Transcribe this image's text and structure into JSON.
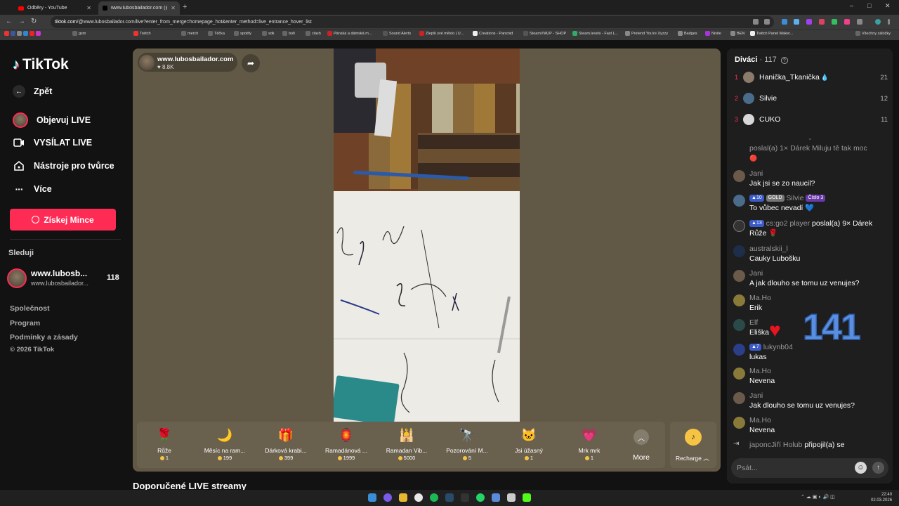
{
  "browser": {
    "tabs": [
      {
        "title": "Odběry - YouTube"
      },
      {
        "title": "www.lubosbailador.com (@l..."
      }
    ],
    "url_host": "tiktok.com",
    "url_rest": "/@www.lubosbailador.com/live?enter_from_merge=homepage_hot&enter_method=live_entrance_hover_list",
    "bookmarks": [
      "gsm",
      "Twitch",
      "merch",
      "Těčka",
      "spotify",
      "sdk",
      "bolt",
      "clash",
      "Pánská a dámská m...",
      "Sound Alerts",
      "Zlepši své město | U...",
      "Creations - Panzoid",
      "SteamVMUP - SHOP",
      "Steam.levels - Fast L...",
      "Pretend You're Xyzzy",
      "Badges",
      "Nivite",
      "BEN",
      "Twitch Panel Maker..."
    ],
    "bookmarks_right": "Všechny záložky"
  },
  "sidebar": {
    "logo": "TikTok",
    "back": "Zpět",
    "nav": [
      {
        "label": "Objevuj LIVE",
        "icon": "avatar-icon"
      },
      {
        "label": "VYSÍLAT LIVE",
        "icon": "video-camera-icon"
      },
      {
        "label": "Nástroje pro tvůrce",
        "icon": "home-icon"
      },
      {
        "label": "Více",
        "icon": "more-dots-icon"
      }
    ],
    "coins_button": "Získej Mince",
    "following_title": "Sleduji",
    "following": {
      "name": "www.lubosb...",
      "handle": "www.lubosbailador...",
      "count": "118"
    },
    "footer": [
      "Společnost",
      "Program",
      "Podmínky a zásady",
      "© 2026 TikTok"
    ]
  },
  "stream": {
    "host_name": "www.lubosbailador.com",
    "host_likes": "8.8K"
  },
  "gifts": [
    {
      "name": "Růže",
      "price": "1",
      "icon": "rose-icon",
      "glyph": "🌹"
    },
    {
      "name": "Měsíc na ram...",
      "price": "199",
      "icon": "moon-icon",
      "glyph": "🌙"
    },
    {
      "name": "Dárková krabi...",
      "price": "399",
      "icon": "gift-box-icon",
      "glyph": "🎁"
    },
    {
      "name": "Ramadánová ...",
      "price": "1999",
      "icon": "lantern-icon",
      "glyph": "🏮"
    },
    {
      "name": "Ramadan Vib...",
      "price": "5000",
      "icon": "mosque-icon",
      "glyph": "🕌"
    },
    {
      "name": "Pozorování M...",
      "price": "5",
      "icon": "telescope-icon",
      "glyph": "🔭"
    },
    {
      "name": "Jsi úžasný",
      "price": "1",
      "icon": "cat-icon",
      "glyph": "🐱"
    },
    {
      "name": "Mrk mrk",
      "price": "1",
      "icon": "heart-icon",
      "glyph": "💗"
    }
  ],
  "gift_more": "More",
  "recharge": "Recharge",
  "recommended_title": "Doporučené LIVE streamy",
  "chat": {
    "viewers_label": "Diváci",
    "viewers_count": "117",
    "top_viewers": [
      {
        "rank": "1",
        "name": "Hanička_Tkanička",
        "score": "21",
        "color": "#8a7b6b"
      },
      {
        "rank": "2",
        "name": "Silvie",
        "score": "12",
        "color": "#4a6b8a"
      },
      {
        "rank": "3",
        "name": "CUKO",
        "score": "11",
        "color": "#d8d8d8"
      }
    ],
    "partial_msg": "poslal(a) 1× Dárek Miluju tě tak moc",
    "messages": [
      {
        "name": "Jani",
        "text": "Jak jsi se zo naucil?",
        "color": "#6b5a4a"
      },
      {
        "name": "Silvie",
        "badge1": "10",
        "badge2": "GOLD",
        "badge3": "Číslo 3",
        "text": "To vůbec nevadí 💙",
        "color": "#4a6b8a"
      },
      {
        "name": "cs:go2 player",
        "badge1": "13",
        "text": "poslal(a) 9× Dárek Růže 🌹",
        "color": "#333"
      },
      {
        "name": "australskii_l",
        "text": "Cauky Lubošku",
        "color": "#1e2e4a"
      },
      {
        "name": "Jani",
        "text": "A jak dlouho se tomu uz venujes?",
        "color": "#6b5a4a"
      },
      {
        "name": "Ma.Ho",
        "text": "Erik",
        "color": "#8a7a3a"
      },
      {
        "name": "Elf",
        "text": "Eliška",
        "color": "#2a4a4a"
      },
      {
        "name": "lukynb04",
        "badge1": "7",
        "text": "lukas",
        "color": "#2a3e8a"
      },
      {
        "name": "Ma.Ho",
        "text": "Nevena",
        "color": "#8a7a3a"
      },
      {
        "name": "Jani",
        "text": "Jak dlouho se tomu uz venujes?",
        "color": "#6b5a4a"
      },
      {
        "name": "Ma.Ho",
        "text": "Nevena",
        "color": "#8a7a3a"
      }
    ],
    "join_name": "japoncJiří Holub",
    "join_text": "připojil(a) se",
    "overlay_number": "141",
    "input_placeholder": "Psát..."
  },
  "taskbar": {
    "time": "22:40",
    "date": "02.03.2026"
  }
}
